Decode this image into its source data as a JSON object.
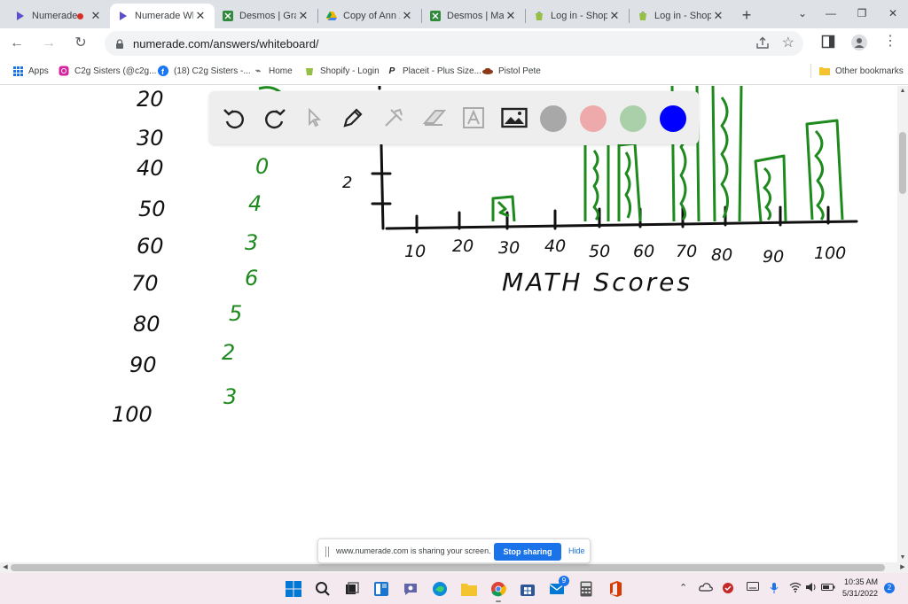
{
  "browser": {
    "tabs": [
      {
        "title": "Numerade",
        "recording": true,
        "active": false
      },
      {
        "title": "Numerade Wh",
        "active": true
      },
      {
        "title": "Desmos | Grap",
        "active": false
      },
      {
        "title": "Copy of Ann X",
        "active": false
      },
      {
        "title": "Desmos | Matr",
        "active": false
      },
      {
        "title": "Log in - Shopif",
        "active": false
      },
      {
        "title": "Log in - Shopif",
        "active": false
      }
    ],
    "new_tab": "+",
    "url": "numerade.com/answers/whiteboard/",
    "bookmarks": [
      {
        "label": "Apps",
        "icon": "apps-grid-icon"
      },
      {
        "label": "C2g Sisters (@c2g...",
        "icon": "instagram-icon"
      },
      {
        "label": "(18) C2g Sisters -...",
        "icon": "facebook-icon"
      },
      {
        "label": "Home",
        "icon": "home-icon"
      },
      {
        "label": "Shopify - Login",
        "icon": "shopify-icon"
      },
      {
        "label": "Placeit - Plus Size...",
        "icon": "placeit-icon"
      },
      {
        "label": "Pistol Pete",
        "icon": "pistol-pete-icon"
      }
    ],
    "other_bookmarks": "Other bookmarks"
  },
  "whiteboard": {
    "ink_green": "#1e8a1e",
    "ink_black": "#111111",
    "left_column": [
      "20",
      "30",
      "40",
      "50",
      "60",
      "70",
      "80",
      "90",
      "100"
    ],
    "right_column": [
      "0",
      "4",
      "3",
      "6",
      "5",
      "2",
      "3"
    ],
    "y_tick_label": "2",
    "x_labels": [
      "10",
      "20",
      "30",
      "40",
      "50",
      "60",
      "70",
      "80",
      "90",
      "100"
    ],
    "x_title": "MATH Scores",
    "tools": [
      "undo-icon",
      "redo-icon",
      "pointer-icon",
      "pen-icon",
      "tools-icon",
      "eraser-icon",
      "text-icon",
      "image-icon"
    ],
    "colors": [
      "#a8a8a8",
      "#eeaaaa",
      "#aad0aa",
      "#0000ff"
    ]
  },
  "share_banner": {
    "message": "www.numerade.com is sharing your screen.",
    "stop": "Stop sharing",
    "hide": "Hide"
  },
  "taskbar": {
    "time": "10:35 AM",
    "date": "5/31/2022",
    "notifications": "2",
    "mail_badge": "9"
  }
}
